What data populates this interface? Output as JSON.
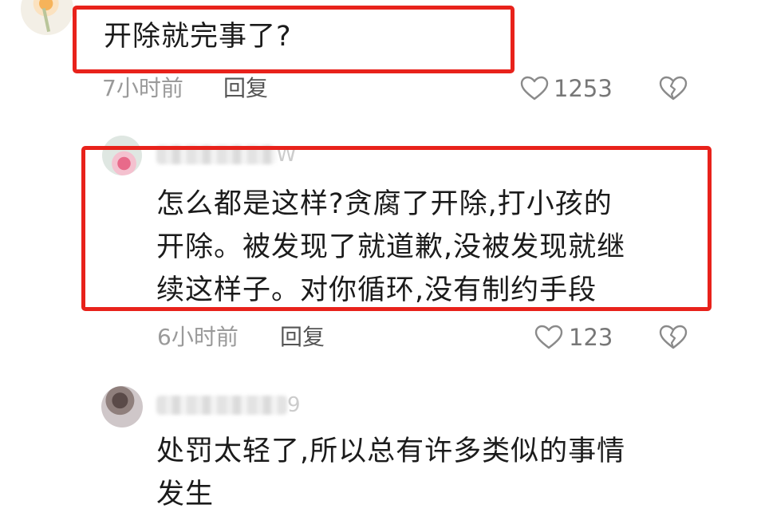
{
  "colors": {
    "highlight_border": "#e8221b",
    "text": "#1b1b1b",
    "meta": "#9a9a9a"
  },
  "comments": [
    {
      "text_lines": [
        "开除就完事了?"
      ],
      "time": "7小时前",
      "reply_label": "回复",
      "like_count": "1253"
    },
    {
      "author_fragment": "W",
      "text_lines": [
        "怎么都是这样?贪腐了开除,打小孩的",
        "开除。被发现了就道歉,没被发现就继",
        "续这样子。对你循环,没有制约手段"
      ],
      "time": "6小时前",
      "reply_label": "回复",
      "like_count": "123"
    },
    {
      "author_fragment": "9",
      "text_lines": [
        "处罚太轻了,所以总有许多类似的事情",
        "发生"
      ]
    }
  ],
  "icons": {
    "like": "heart-outline-icon",
    "dislike": "broken-heart-icon"
  }
}
